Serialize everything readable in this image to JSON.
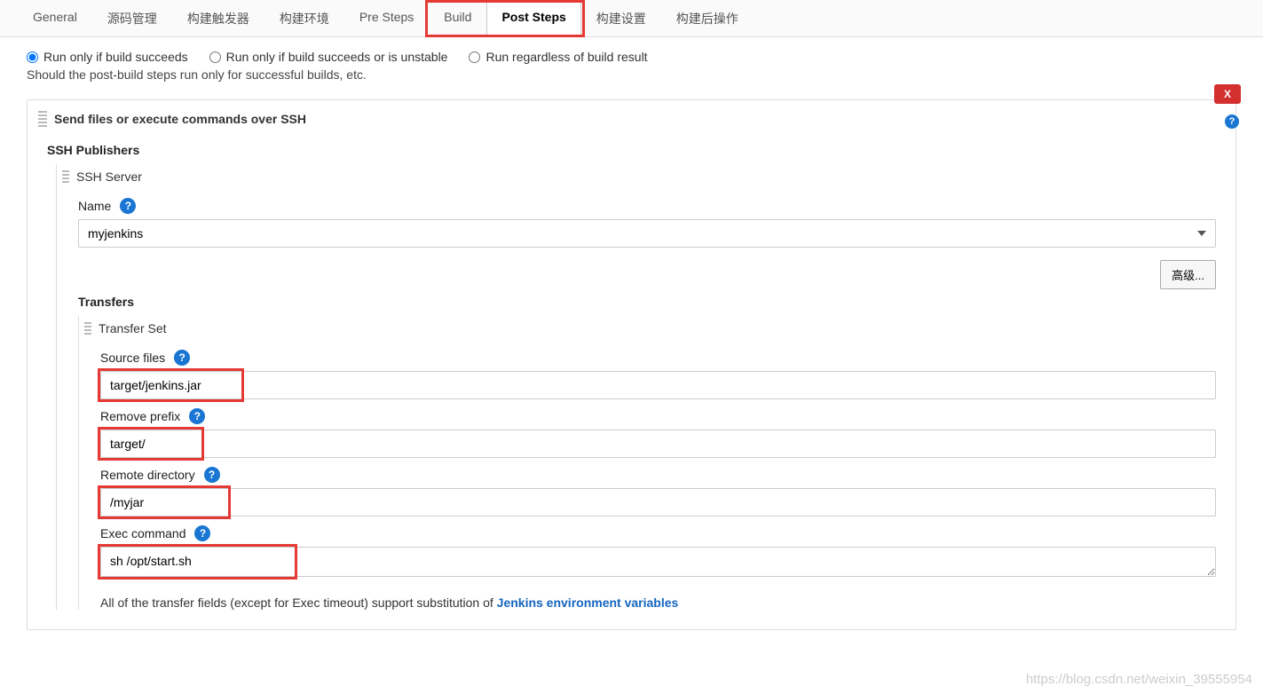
{
  "tabs": {
    "items": [
      "General",
      "源码管理",
      "构建触发器",
      "构建环境",
      "Pre Steps",
      "Build",
      "Post Steps",
      "构建设置",
      "构建后操作"
    ],
    "active_index": 6
  },
  "run_options": {
    "opt1": "Run only if build succeeds",
    "opt2": "Run only if build succeeds or is unstable",
    "opt3": "Run regardless of build result",
    "selected": 0,
    "hint": "Should the post-build steps run only for successful builds, etc."
  },
  "section": {
    "title": "Send files or execute commands over SSH",
    "close": "X",
    "publishers_label": "SSH Publishers",
    "server": {
      "header": "SSH Server",
      "name_label": "Name",
      "name_value": "myjenkins",
      "advanced_btn": "高级..."
    },
    "transfers": {
      "header": "Transfers",
      "set_header": "Transfer Set",
      "source_label": "Source files",
      "source_value": "target/jenkins.jar",
      "remove_prefix_label": "Remove prefix",
      "remove_prefix_value": "target/",
      "remote_dir_label": "Remote directory",
      "remote_dir_value": "/myjar",
      "exec_label": "Exec command",
      "exec_value": "sh /opt/start.sh",
      "footer_pre": "All of the transfer fields (except for Exec timeout) support substitution of ",
      "footer_link": "Jenkins environment variables"
    }
  },
  "watermark": "https://blog.csdn.net/weixin_39555954"
}
